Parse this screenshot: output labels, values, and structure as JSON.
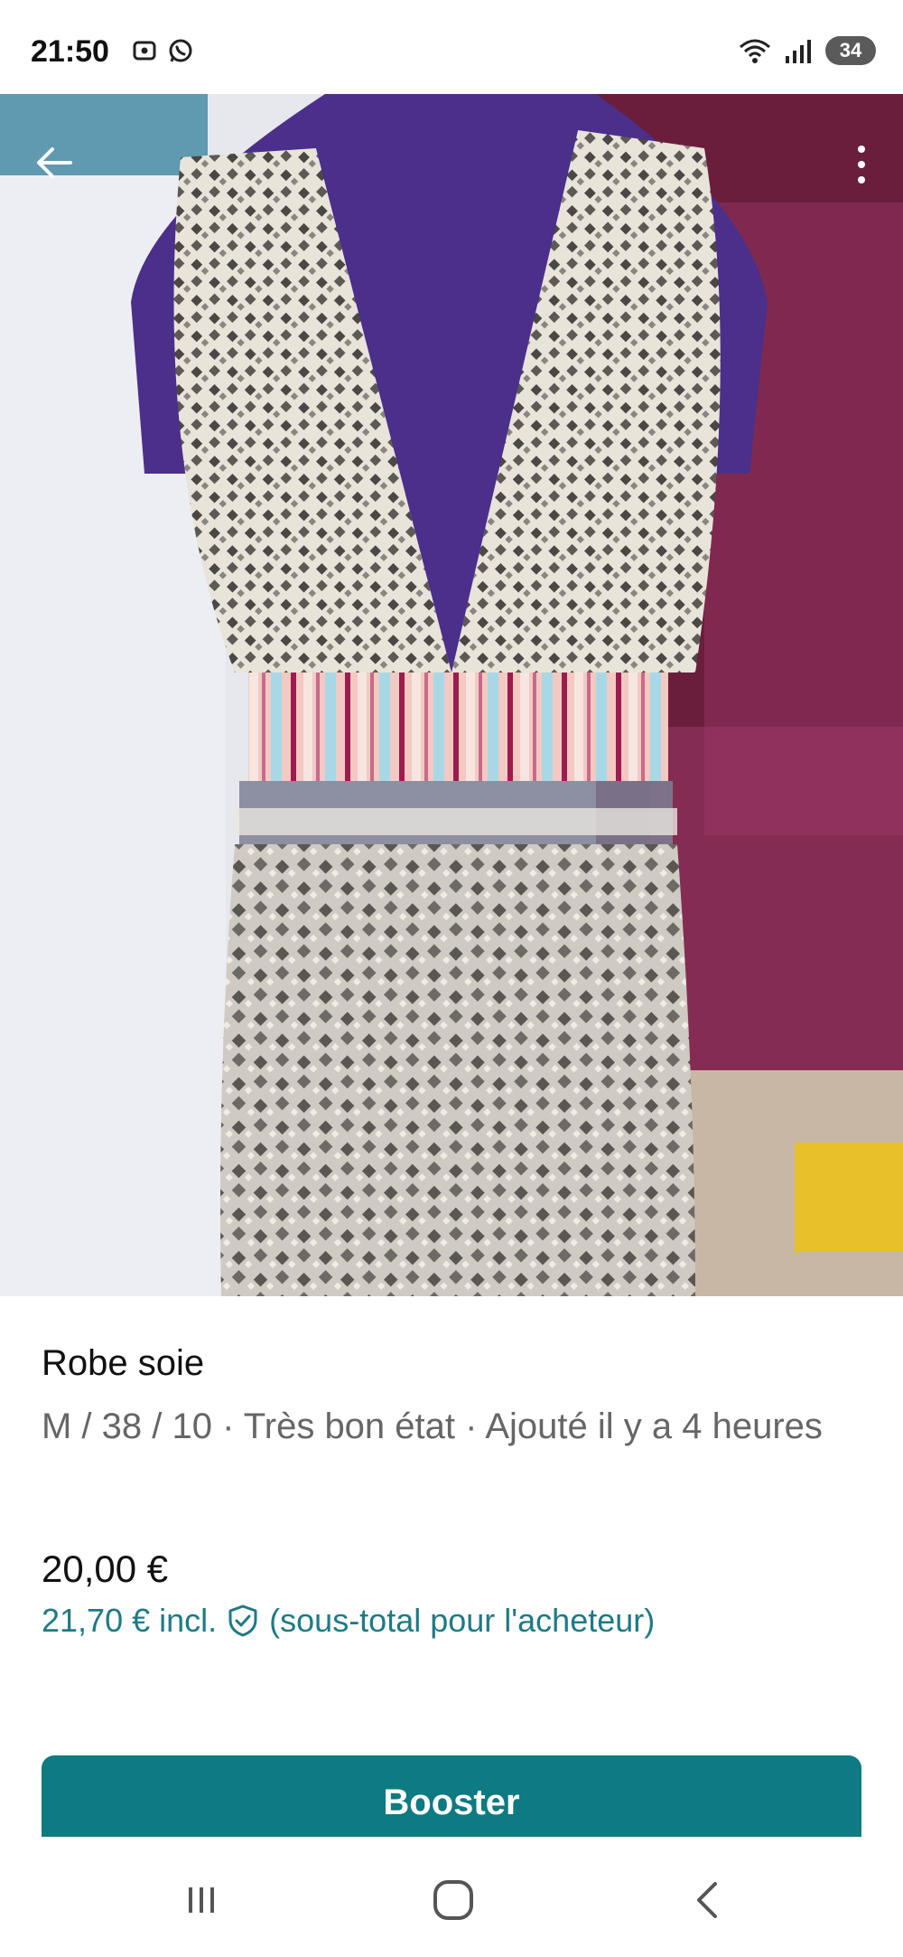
{
  "status_bar": {
    "time": "21:50",
    "battery": "34",
    "left_icons": [
      "screenshot-icon",
      "whatsapp-icon"
    ],
    "right_icons": [
      "wifi-icon",
      "signal-icon",
      "battery-icon"
    ]
  },
  "photo": {
    "icons": {
      "back": "arrow-left-icon",
      "more": "more-vertical-icon"
    },
    "carousel_dot_count": 5,
    "carousel_active_index": 3
  },
  "item": {
    "title": "Robe soie",
    "details": "M / 38 / 10 · Très bon état · Ajouté il y a 4 heures",
    "price": "20,00 €",
    "price_incl_amount": "21,70 €",
    "price_incl_label": "incl.",
    "price_incl_note": "(sous-total pour l'acheteur)"
  },
  "actions": {
    "boost_label": "Booster"
  },
  "nav": {
    "icons": [
      "recent-apps-icon",
      "home-icon",
      "back-icon"
    ]
  },
  "colors": {
    "accent": "#0e7a82",
    "link": "#1f7a84",
    "text": "#111111",
    "muted": "#666666"
  }
}
